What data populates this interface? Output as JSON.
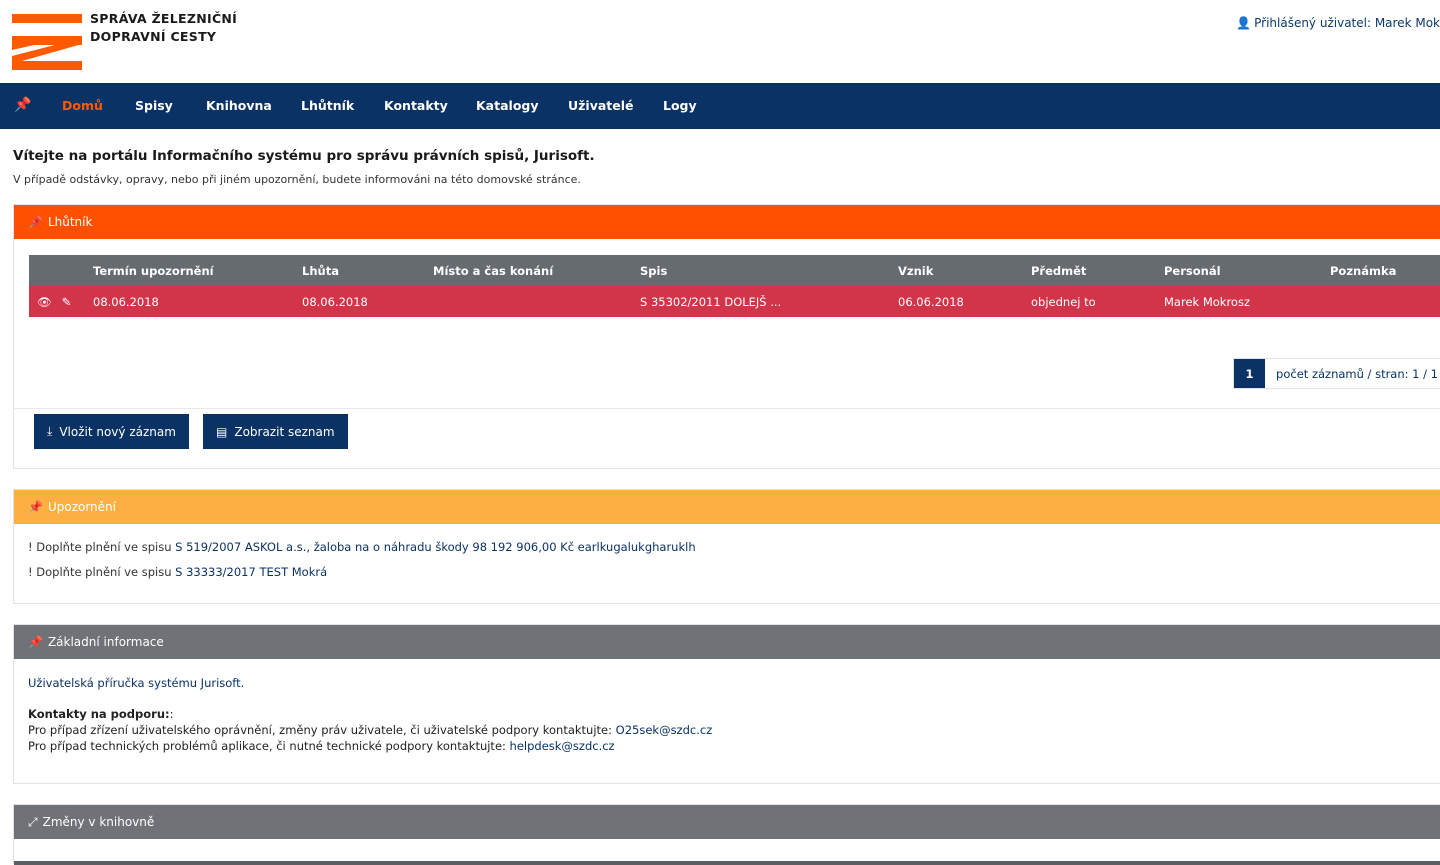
{
  "brand": {
    "line1": "SPRÁVA ŽELEZNIČNÍ",
    "line2": "DOPRAVNÍ CESTY",
    "colors": {
      "orange": "#ff5a00",
      "navy": "#0a3264"
    }
  },
  "user": {
    "icon": "user-icon",
    "text": "Přihlášený uživatel: Marek Mok"
  },
  "nav": {
    "items": [
      "Domů",
      "Spisy",
      "Knihovna",
      "Lhůtník",
      "Kontakty",
      "Katalogy",
      "Uživatelé",
      "Logy"
    ],
    "active": "Domů"
  },
  "intro": {
    "title": "Vítejte na portálu Informačního systému pro správu právních spisů, Jurisoft.",
    "subtitle": "V případě odstávky, opravy, nebo při jiném upozornění, budete informováni na této domovské stránce."
  },
  "lhutnik": {
    "title": "Lhůtník",
    "columns": [
      "Termín upozornění",
      "Lhůta",
      "Místo a čas konání",
      "Spis",
      "Vznik",
      "Předmět",
      "Personál",
      "Poznámka"
    ],
    "rows": [
      {
        "termin": "08.06.2018",
        "lhuta": "08.06.2018",
        "misto": "",
        "spis": "S 35302/2011 DOLEJŠ ...",
        "vznik": "06.06.2018",
        "predmet": "objednej to",
        "personal": "Marek Mokrosz",
        "poznamka": ""
      }
    ],
    "pager": {
      "page": "1",
      "text": "počet záznamů / stran: 1 / 1"
    },
    "buttons": {
      "new": "Vložit nový záznam",
      "list": "Zobrazit seznam"
    }
  },
  "upozorneni": {
    "title": "Upozornění",
    "items": [
      {
        "prefix": "! Doplňte plnění ve spisu ",
        "link": "S 519/2007 ASKOL a.s., žaloba na o náhradu škody 98 192 906,00 Kč earlkugalukgharuklh"
      },
      {
        "prefix": "! Doplňte plnění ve spisu ",
        "link": "S 33333/2017 TEST Mokrá"
      }
    ]
  },
  "zakladni": {
    "title": "Základní informace",
    "manual": "Uživatelská příručka systému Jurisoft.",
    "contacts_head": "Kontakty na podporu:",
    "contacts_head_suffix": ":",
    "line1": "Pro případ zřízení uživatelského oprávnění, změny práv uživatele, či uživatelské podpory kontaktujte: ",
    "email1": "O25sek@szdc.cz",
    "line2": "Pro případ technických problémů aplikace, či nutné technické podpory kontaktujte: ",
    "email2": "helpdesk@szdc.cz"
  },
  "zmeny": {
    "title": "Změny v knihovně"
  }
}
